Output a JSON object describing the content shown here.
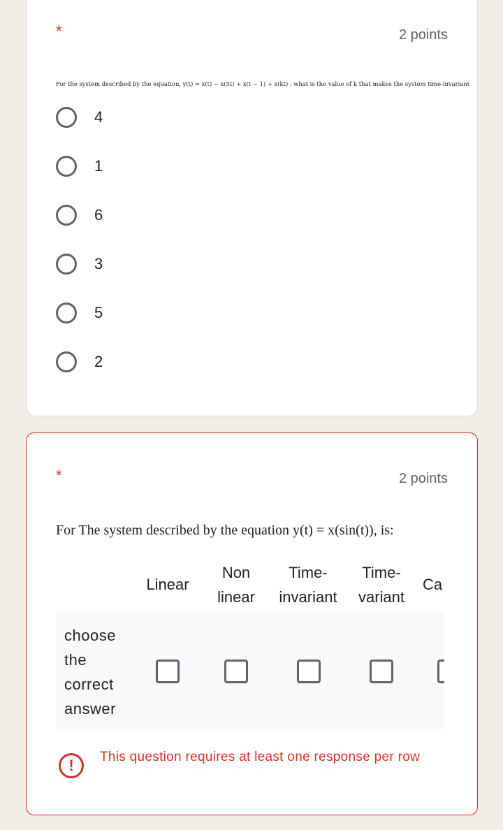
{
  "question1": {
    "required_mark": "*",
    "points": "2 points",
    "text": "For the system described by the equation, y(t) = x(t) − x(5t) + x(t − 1) + x(kt) . what is the value of k that makes the system time-invariant",
    "options": [
      "4",
      "1",
      "6",
      "3",
      "5",
      "2"
    ]
  },
  "question2": {
    "required_mark": "*",
    "points": "2 points",
    "text": "For The system described by the equation y(t) = x(sin(t)),  is:",
    "columns": [
      {
        "line1": "Linear",
        "line2": ""
      },
      {
        "line1": "Non",
        "line2": "linear"
      },
      {
        "line1": "Time-",
        "line2": "invariant"
      },
      {
        "line1": "Time-",
        "line2": "variant"
      },
      {
        "line1": "Ca",
        "line2": ""
      }
    ],
    "row_label": [
      "choose",
      "the",
      "correct",
      "answer"
    ],
    "error": {
      "icon": "!",
      "message": "This question requires at least one response per row"
    }
  },
  "colors": {
    "background": "#f2ede6",
    "card": "#ffffff",
    "error_red": "#d93025",
    "radio_gray": "#5f6368"
  }
}
